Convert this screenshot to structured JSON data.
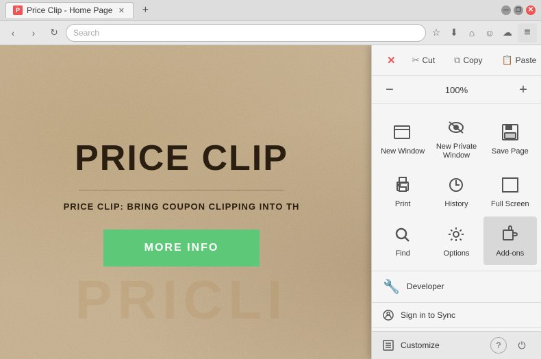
{
  "titlebar": {
    "tab_title": "Price Clip - Home Page",
    "tab_favicon": "P",
    "new_tab_label": "+",
    "controls": {
      "minimize": "—",
      "restore": "❐",
      "close": "✕"
    }
  },
  "navbar": {
    "back": "‹",
    "forward": "›",
    "refresh": "↻",
    "search_placeholder": "Search",
    "bookmark_icon": "☆",
    "download_icon": "⬇",
    "home_icon": "⌂",
    "emoji_icon": "☺",
    "sync_icon": "☁",
    "hamburger_icon": "≡"
  },
  "webpage": {
    "title": "PRICE CLIP",
    "subtitle": "PRICE CLIP: BRING COUPON CLIPPING INTO TH",
    "more_info": "MORE INFO",
    "watermark": "PRICLI"
  },
  "menu": {
    "cut_label": "Cut",
    "copy_label": "Copy",
    "paste_label": "Paste",
    "zoom_minus": "−",
    "zoom_value": "100%",
    "zoom_plus": "+",
    "items": [
      {
        "id": "new-window",
        "label": "New Window",
        "icon_type": "window"
      },
      {
        "id": "private-window",
        "label": "New Private\nWindow",
        "icon_type": "private"
      },
      {
        "id": "save-page",
        "label": "Save Page",
        "icon_type": "save"
      },
      {
        "id": "print",
        "label": "Print",
        "icon_type": "print"
      },
      {
        "id": "history",
        "label": "History",
        "icon_type": "history"
      },
      {
        "id": "full-screen",
        "label": "Full Screen",
        "icon_type": "fullscreen"
      },
      {
        "id": "find",
        "label": "Find",
        "icon_type": "find"
      },
      {
        "id": "options",
        "label": "Options",
        "icon_type": "options"
      },
      {
        "id": "add-ons",
        "label": "Add-ons",
        "icon_type": "addons",
        "active": true
      }
    ],
    "developer_label": "Developer",
    "signin_label": "Sign in to Sync",
    "customize_label": "Customize",
    "help_icon": "?",
    "power_icon": "⏻"
  }
}
